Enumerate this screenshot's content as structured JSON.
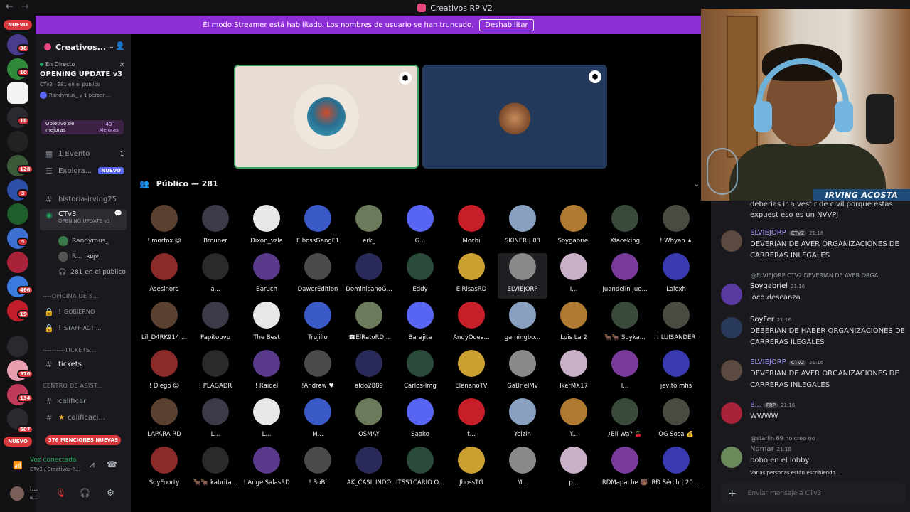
{
  "window": {
    "title": "Creativos RP V2"
  },
  "banner": {
    "text": "El modo Streamer está habilitado. Los nombres de usuario se han truncado.",
    "button": "Deshabilitar"
  },
  "guilds": {
    "nuevo_top": "NUEVO",
    "nuevo_bottom": "NUEVO",
    "counts": [
      "36",
      "10",
      "18",
      "128",
      "3",
      "4",
      "466",
      "19",
      "376",
      "134",
      "507"
    ]
  },
  "server": {
    "name": "Creativos..."
  },
  "live": {
    "tag": "En Directo",
    "title": "OPENING UPDATE v3",
    "meta": "CTv3 · 281 en el público",
    "meta2": "Randymus_ y 1 person..."
  },
  "boost": {
    "label": "Objetivo de mejoras",
    "value": "43 Mejoras"
  },
  "channels": {
    "evento": "1 Evento",
    "evento_count": "1",
    "explora": "Explora...",
    "nuevo": "NUEVO",
    "historia": "historia-irving25",
    "ctv3": "CTv3",
    "ctv3_sub": "OPENING UPDATE v3",
    "sub1": "Randymus_",
    "sub2": "R...",
    "sub2_tag": "RDJV",
    "sub3": "281 en el público",
    "cat1": "----OFICINA DE S...",
    "gobierno": "GOBIERNO",
    "staff": "STAFF ACTI...",
    "cat2": "----------TICKETS...",
    "tickets": "tickets",
    "cat3": "CENTRO DE ASIST...",
    "calificar": "calificar",
    "calificaciones": "calificaci...",
    "mentions": "376 MENCIONES NUEVAS"
  },
  "voice": {
    "title": "Voz conectada",
    "sub": "CTv3 / Creativos R..."
  },
  "user": {
    "name": "I...",
    "status": "E..."
  },
  "stage": {
    "audience": "Público — 281"
  },
  "members": [
    "! morfox ☺",
    "Brouner",
    "Dixon_vzla",
    "ElbossGangF1",
    "erk_",
    "G...",
    "Mochi",
    "SKINER | 03",
    "Soygabriel",
    "Xfaceking",
    "! Whyan ★",
    "Asesinord",
    "a...",
    "Baruch",
    "DawerEdition",
    "DominicanoG...",
    "Eddy",
    "ElRisasRD",
    "ELVIEJORP",
    "I...",
    "Juandelin Jue...",
    "Lalexh",
    "Lil_D4RK914 ...",
    "Papitopvp",
    "The Best",
    "Trujillo",
    "☎ElRatoRD...",
    "Barajita",
    "AndyOcea...",
    "gamingbo...",
    "Luis La 2",
    "🐂🐂 Soyka...",
    "! LUISANDER",
    "! Diego ☺",
    "! PLAGADR",
    "! Raidel",
    "!Andrew ♥",
    "aldo2889",
    "Carlos-lmg",
    "ElenanoTV",
    "GaBrielMv",
    "IkerMX17",
    "I...",
    "jevito mhs",
    "LAPARA RD",
    "L...",
    "L...",
    "M...",
    "OSMAY",
    "Saoko",
    "t...",
    "Yeizin",
    "Y...",
    "¿Eli Wa? 🍒",
    "OG Sosa 💰",
    "SoyFoorty",
    "🐂🐂 kabrita...",
    "! AngelSalasRD",
    "! BuBi",
    "AK_CASILINDO",
    "ITSS1CARIO O...",
    "JhossTG",
    "M...",
    "p...",
    "RDMapache 🐻",
    "RĐ Šěrch | 20 ..."
  ],
  "chat": {
    "top_text": "deberias ir a vestir de civil porque estas expuest eso es un NVVPJ",
    "m1": {
      "name": "ELVIEJORP",
      "tag": "CTV2",
      "time": "21:16",
      "text": "DEVERIAN DE AVER ORGANIZACIONES DE CARRERAS INLEGALES"
    },
    "reply1": "@ELVIEJORP CTV2 DEVERIAN DE AVER ORGA",
    "m2": {
      "name": "Soygabriel",
      "time": "21:16",
      "text": "loco descanza"
    },
    "m3": {
      "name": "SoyFer",
      "time": "21:16",
      "text": "DEBERIAN DE HABER ORGANIZACIONES DE CARRERAS ILEGALES"
    },
    "m4": {
      "name": "ELVIEJORP",
      "tag": "CTV2",
      "time": "21:16",
      "text": "DEVERIAN DE AVER ORGANIZACIONES DE CARRERAS INLEGALES"
    },
    "m5": {
      "name": "E...",
      "tag": "FRP",
      "time": "21:16",
      "text": "WWWW"
    },
    "reply2": "@starlin 69 no creo no",
    "m6": {
      "name": "Nomar",
      "time": "21:16",
      "text": "bobo en el lobby"
    },
    "typing": "Varias personas están escribiendo...",
    "input_placeholder": "Enviar mensaje a CTv3"
  },
  "webcam": {
    "name": "IRVING ACOSTA"
  },
  "colors": {
    "accent": "#8e2fd6",
    "live": "#23a55a",
    "badge": "#da373c",
    "link": "#5865f2"
  }
}
